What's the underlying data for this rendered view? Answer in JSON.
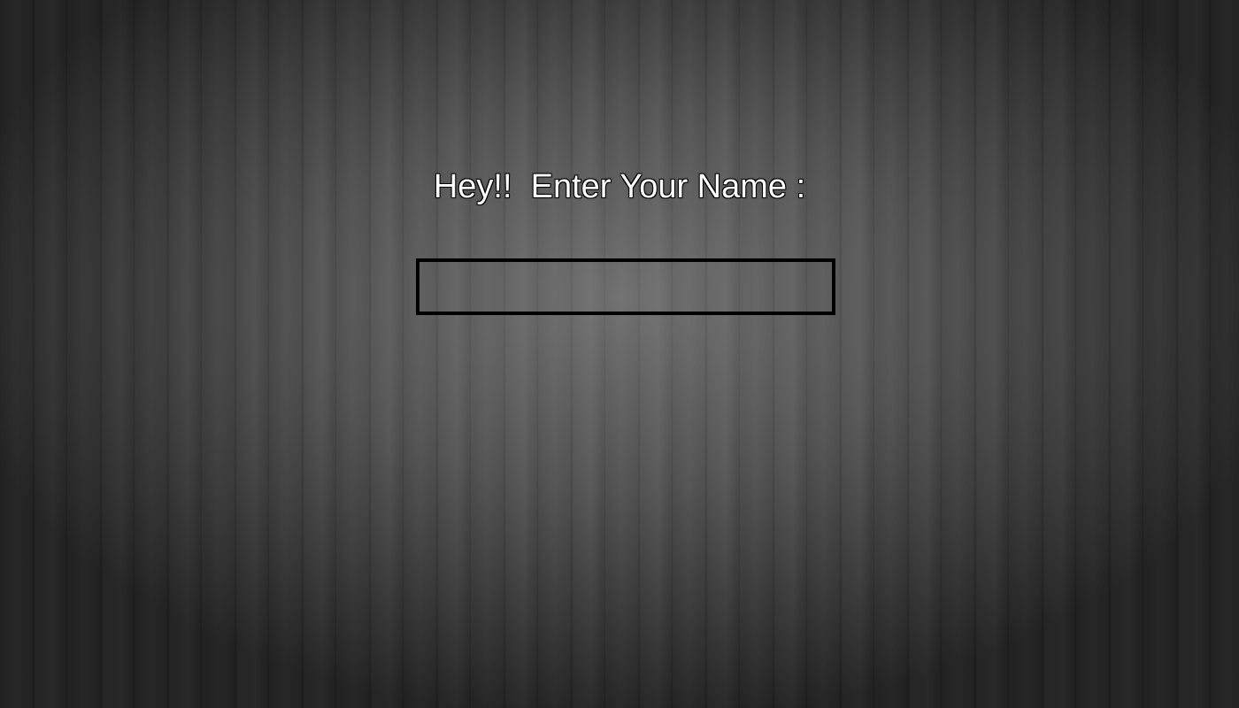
{
  "prompt": {
    "heading": "Hey!!  Enter Your Name :"
  },
  "name_input": {
    "value": "",
    "placeholder": ""
  },
  "colors": {
    "text": "#ffffff",
    "input_border": "#000000"
  }
}
